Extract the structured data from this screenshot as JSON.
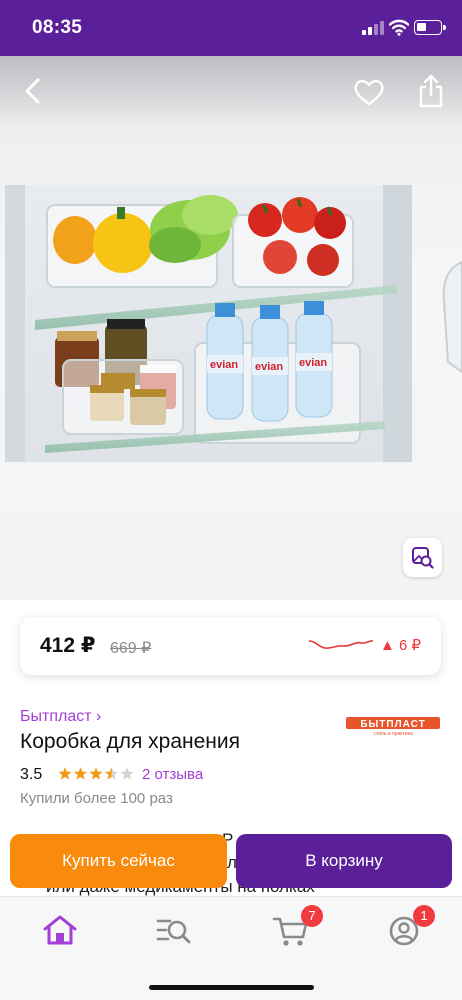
{
  "status_bar": {
    "time": "08:35"
  },
  "header": {
    "back_icon": "chevron-left-icon",
    "favorite_icon": "heart-outline-icon",
    "share_icon": "share-icon"
  },
  "gallery": {
    "photo_alt": "Коробка для хранения",
    "similar_search_icon": "image-search-icon"
  },
  "price": {
    "current": "412 ₽",
    "old": "669 ₽",
    "change": "▲ 6 ₽",
    "change_color": "#f2373b"
  },
  "product": {
    "brand": "Бытпласт ›",
    "brand_logo_text": "БЫТПЛАСТ",
    "brand_logo_tagline": "стиль и практика",
    "title": "Коробка для хранения",
    "rating": "3.5",
    "rating_value": 3.5,
    "rating_max": 5,
    "reviews": "2 отзыва",
    "bought": "Купили более 100 раз"
  },
  "description_peek": {
    "line1_tail": "Р",
    "line2_tail": "л",
    "line3": "или даже медикаменты на полках"
  },
  "actions": {
    "buy_now": "Купить сейчас",
    "add_to_cart": "В корзину"
  },
  "bottom_nav": {
    "items": [
      {
        "name": "home",
        "icon": "home-icon"
      },
      {
        "name": "catalog",
        "icon": "catalog-search-icon"
      },
      {
        "name": "cart",
        "icon": "cart-icon",
        "badge": "7"
      },
      {
        "name": "profile",
        "icon": "profile-icon",
        "badge": "1"
      }
    ]
  },
  "colors": {
    "brand_purple": "#5b1f99",
    "link_purple": "#a23fd6",
    "buy_orange": "#f88a0e",
    "badge_red": "#f23b3f"
  }
}
